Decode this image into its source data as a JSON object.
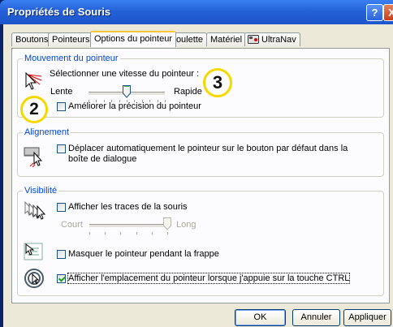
{
  "window": {
    "title": "Propriétés de Souris",
    "help_label": "?",
    "close_label": "X"
  },
  "tabs": [
    {
      "label": "Boutons"
    },
    {
      "label": "Pointeurs"
    },
    {
      "label": "Options du pointeur",
      "active": true
    },
    {
      "label": "Roulette"
    },
    {
      "label": "Matériel"
    },
    {
      "label": "UltraNav"
    }
  ],
  "motion": {
    "title": "Mouvement du pointeur",
    "speed_label": "Sélectionner une vitesse du pointeur :",
    "slow": "Lente",
    "fast": "Rapide",
    "speed_value": 0.5,
    "precision_label": "Améliorer la précision du pointeur",
    "precision_checked": false
  },
  "snap": {
    "title": "Alignement",
    "line1": "Déplacer automatiquement le pointeur sur le bouton par défaut dans la",
    "line2": "boîte de dialogue",
    "checked": false
  },
  "visibility": {
    "title": "Visibilité",
    "trails_label": "Afficher les traces de la souris",
    "trails_checked": false,
    "short": "Court",
    "long": "Long",
    "trails_value": 1.0,
    "hide_label": "Masquer le pointeur pendant la frappe",
    "hide_checked": false,
    "ctrl_label": "Afficher l'emplacement du pointeur lorsque j'appuie sur la touche CTRL",
    "ctrl_checked": true
  },
  "buttons": {
    "ok": "OK",
    "cancel": "Annuler",
    "apply": "Appliquer"
  },
  "callouts": {
    "two": "2",
    "three": "3"
  }
}
